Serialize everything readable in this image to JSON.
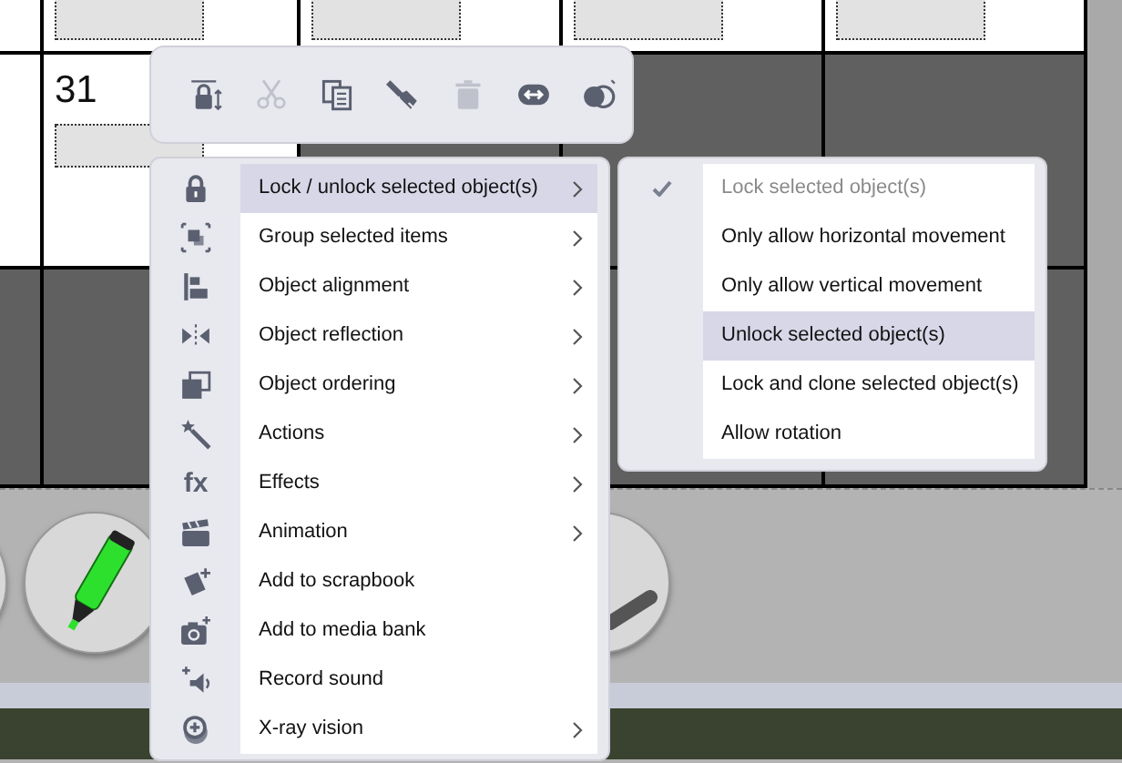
{
  "calendar": {
    "date": "31"
  },
  "toolbar": {
    "buttons": [
      {
        "kind": "lock-arrows",
        "disabled": false
      },
      {
        "kind": "scissors",
        "disabled": true
      },
      {
        "kind": "copy",
        "disabled": false
      },
      {
        "kind": "brush",
        "disabled": false
      },
      {
        "kind": "trash",
        "disabled": true
      },
      {
        "kind": "link",
        "disabled": false
      },
      {
        "kind": "circles",
        "disabled": false
      }
    ]
  },
  "context_menu": {
    "items": [
      {
        "label": "Lock / unlock selected object(s)",
        "kind": "lock",
        "submenu": true,
        "selected": true
      },
      {
        "label": "Group selected items",
        "kind": "group",
        "submenu": true,
        "selected": false
      },
      {
        "label": "Object alignment",
        "kind": "align",
        "submenu": true,
        "selected": false
      },
      {
        "label": "Object reflection",
        "kind": "reflect",
        "submenu": true,
        "selected": false
      },
      {
        "label": "Object ordering",
        "kind": "order",
        "submenu": true,
        "selected": false
      },
      {
        "label": "Actions",
        "kind": "wand",
        "submenu": true,
        "selected": false
      },
      {
        "label": "Effects",
        "kind": "text",
        "icon_text": "fx",
        "submenu": true,
        "selected": false
      },
      {
        "label": "Animation",
        "kind": "clapper",
        "submenu": true,
        "selected": false
      },
      {
        "label": "Add to scrapbook",
        "kind": "scrapbook",
        "submenu": false,
        "selected": false
      },
      {
        "label": "Add to media bank",
        "kind": "camera",
        "submenu": false,
        "selected": false
      },
      {
        "label": "Record sound",
        "kind": "speaker",
        "submenu": false,
        "selected": false
      },
      {
        "label": "X-ray vision",
        "kind": "xray",
        "submenu": true,
        "selected": false
      }
    ]
  },
  "submenu": {
    "items": [
      {
        "label": "Lock selected object(s)",
        "checked": true,
        "disabled": true,
        "selected": false
      },
      {
        "label": "Only allow horizontal movement",
        "checked": false,
        "disabled": false,
        "selected": false
      },
      {
        "label": "Only allow vertical movement",
        "checked": false,
        "disabled": false,
        "selected": false
      },
      {
        "label": "Unlock selected object(s)",
        "checked": false,
        "disabled": false,
        "selected": true
      },
      {
        "label": "Lock and clone selected object(s)",
        "checked": false,
        "disabled": false,
        "selected": false
      },
      {
        "label": "Allow rotation",
        "checked": false,
        "disabled": false,
        "selected": false
      }
    ]
  }
}
